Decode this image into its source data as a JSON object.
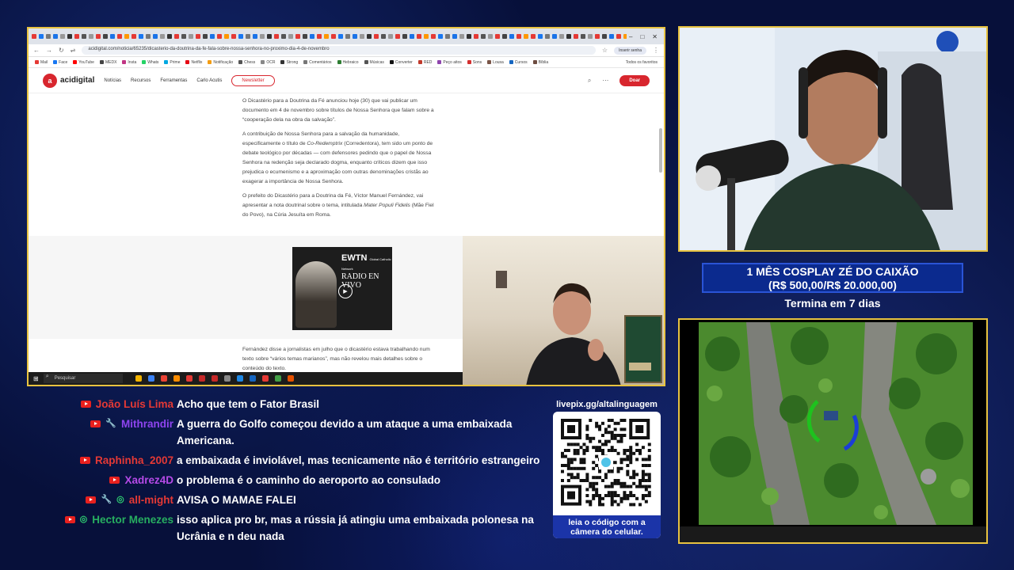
{
  "browser": {
    "url": "acidigital.com/noticia/65235/dicasterio-da-doutrina-da-fe-fala-sobre-nossa-senhora-no-proximo-dia-4-de-novembro",
    "profile_label": "Inserir senha",
    "bookmarks": [
      "Mail",
      "Face",
      "YouTube",
      "MEDX",
      "Insta",
      "Whats",
      "Prime",
      "Netflix",
      "Notificação",
      "Chess",
      "OCR",
      "Strong",
      "Comentários",
      "Hebraico",
      "Músicas",
      "Converter",
      "RED",
      "Peço aitos",
      "Sons",
      "Lousa",
      "Cursos",
      "Bíblia"
    ],
    "all_bookmarks": "Todos os favoritos"
  },
  "site": {
    "logo": "acidigital",
    "logo_mark": "a",
    "nav": [
      "Notícias",
      "Recursos",
      "Ferramentas",
      "Carlo Acutis"
    ],
    "newsletter": "Newsletter",
    "donate": "Doar"
  },
  "article": {
    "p1": "O Dicastério para a Doutrina da Fé anunciou hoje (30) que vai publicar um documento em 4 de novembro sobre títulos de Nossa Senhora que falam sobre a “cooperação dela na obra da salvação”.",
    "p2_a": "A contribuição de Nossa Senhora para a salvação da humanidade, especificamente o título de ",
    "p2_em": "Co-Redemptrix",
    "p2_b": " (Corredentora), tem sido um ponto de debate teológico por décadas — com defensores pedindo que o papel de Nossa Senhora na redenção seja declarado dogma, enquanto críticos dizem que isso prejudica o ecumenismo e a aproximação com outras denominações cristãs ao exagerar a importância de Nossa Senhora.",
    "p3_a": "O prefeito do Dicastério para a Doutrina da Fé, Víctor Manuel Fernández, vai apresentar a nota doutrinal sobre o tema, intitulada ",
    "p3_em": "Mater Populi Fidelis",
    "p3_b": " (Mãe Fiel do Povo), na Cúria Jesuíta em Roma.",
    "p4": "Fernández disse a jornalistas em julho que o dicastério estava trabalhando num texto sobre “vários temas marianos”, mas não revelou mais detalhes sobre o conteúdo do texto."
  },
  "ad": {
    "logo": "EWTN",
    "sub_logo": "Global Catholic Network",
    "title": "RADIO EN VIVO"
  },
  "taskbar": {
    "search_placeholder": "Pesquisar"
  },
  "goal": {
    "line1": "1 MÊS COSPLAY ZÉ DO CAIXÃO",
    "line2": "(R$ 500,00/R$ 20.000,00)",
    "ends": "Termina em 7 dias",
    "raised": 500,
    "target": 20000
  },
  "chat": [
    {
      "user": "João Luís Lima",
      "color": "#e53935",
      "badges": [],
      "text": "Acho que tem o Fator Brasil"
    },
    {
      "user": "Mithrandir",
      "color": "#8e44ef",
      "badges": [
        "wrench"
      ],
      "text": "A guerra do Golfo começou devido a um ataque a uma embaixada Americana."
    },
    {
      "user": "Raphinha_2007",
      "color": "#e53935",
      "badges": [],
      "text": "a embaixada é inviolável, mas tecnicamente não é território estrangeiro"
    },
    {
      "user": "Xadrez4D",
      "color": "#b64ae8",
      "badges": [],
      "text": "o problema é o caminho do aeroporto ao consulado"
    },
    {
      "user": "all-might",
      "color": "#e53935",
      "badges": [
        "wrench",
        "member"
      ],
      "text": "AVISA O MAMAE FALEI"
    },
    {
      "user": "Hector Menezes",
      "color": "#27ae60",
      "badges": [
        "member"
      ],
      "text": "isso aplica pro br, mas a rússia já atingiu uma embaixada polonesa na Ucrânia e n deu nada"
    }
  ],
  "qr": {
    "url": "livepix.gg/altalinguagem",
    "caption": "leia o código com a câmera do celular."
  },
  "colors": {
    "accent_gold": "#e8c340",
    "site_red": "#d8262e",
    "goal_blue": "#0b2a8e"
  },
  "icons": [
    "search-icon",
    "menu-dots-icon",
    "play-icon",
    "youtube-icon",
    "wrench-icon",
    "member-icon",
    "windows-icon"
  ]
}
